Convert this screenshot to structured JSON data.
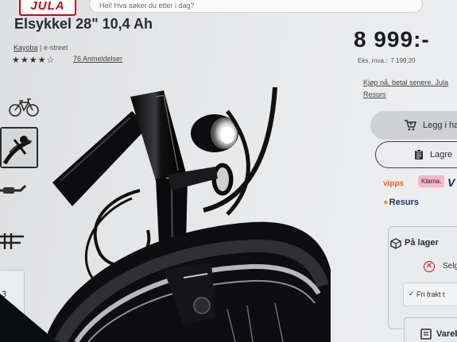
{
  "header": {
    "logo": "JULA",
    "search_placeholder": "Hei! Hva søker du etter i dag?"
  },
  "product": {
    "title": "Elsykkel 28\" 10,4 Ah",
    "brand": "Kayoba",
    "category": "e-street",
    "rating_stars": "★★★★☆",
    "rating": 4,
    "reviews": "76 Anmeldelser",
    "price": "8 999:-",
    "ex_vat_label": "Eks. mva.:",
    "ex_vat_value": "7 199,20"
  },
  "finance": {
    "line1": "Kjøp nå, betal senere. Jula",
    "line2": "Resurs"
  },
  "actions": {
    "add_to_cart": "Legg i ha",
    "save": "Lagre"
  },
  "payment": {
    "vipps": "vipps",
    "klarna": "Klarna.",
    "resurs": "Resurs",
    "visa": "V"
  },
  "stock": {
    "title": "På lager",
    "select_store": "Selg",
    "free_shipping": "Fri frakt t",
    "free_shipping_mark": "✓"
  },
  "vare": {
    "label": "Vareb"
  },
  "thumbnails": {
    "more_count": "3"
  },
  "colors": {
    "brand_red": "#d0021b",
    "stock_red": "#c8102e",
    "vipps_orange": "#ff5b24",
    "klarna_pink": "#f7b7c9"
  }
}
